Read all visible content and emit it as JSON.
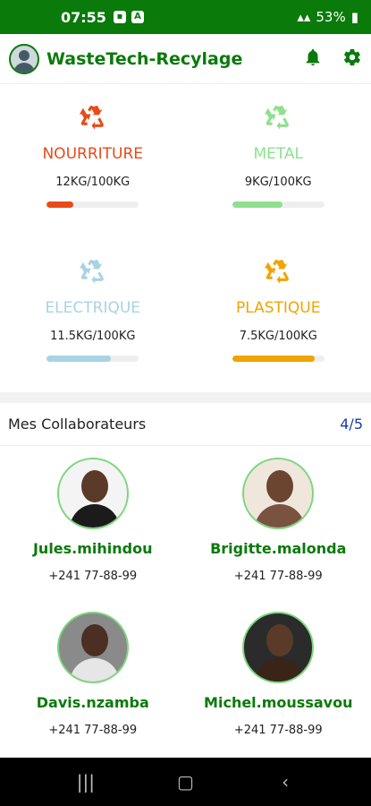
{
  "status": {
    "time": "07:55",
    "battery": "53%"
  },
  "app": {
    "title": "WasteTech-Recylage"
  },
  "categories": [
    {
      "name": "NOURRITURE",
      "amount": "12KG/100KG",
      "progress": 0.29,
      "color": "#e84a1a"
    },
    {
      "name": "METAL",
      "amount": "9KG/100KG",
      "progress": 0.55,
      "color": "#8ee08e"
    },
    {
      "name": "ELECTRIQUE",
      "amount": "11.5KG/100KG",
      "progress": 0.7,
      "color": "#a9d3e3"
    },
    {
      "name": "PLASTIQUE",
      "amount": "7.5KG/100KG",
      "progress": 0.9,
      "color": "#f0a400"
    }
  ],
  "collaborators": {
    "title": "Mes Collaborateurs",
    "count": "4/5",
    "people": [
      {
        "name": "Jules.mihindou",
        "phone": "+241 77-88-99"
      },
      {
        "name": "Brigitte.malonda",
        "phone": "+241 77-88-99"
      },
      {
        "name": "Davis.nzamba",
        "phone": "+241 77-88-99"
      },
      {
        "name": "Michel.moussavou",
        "phone": "+241 77-88-99"
      }
    ]
  },
  "icons": {
    "notifications": "bell-icon",
    "settings": "gear-icon",
    "recycle": "recycle-icon"
  }
}
